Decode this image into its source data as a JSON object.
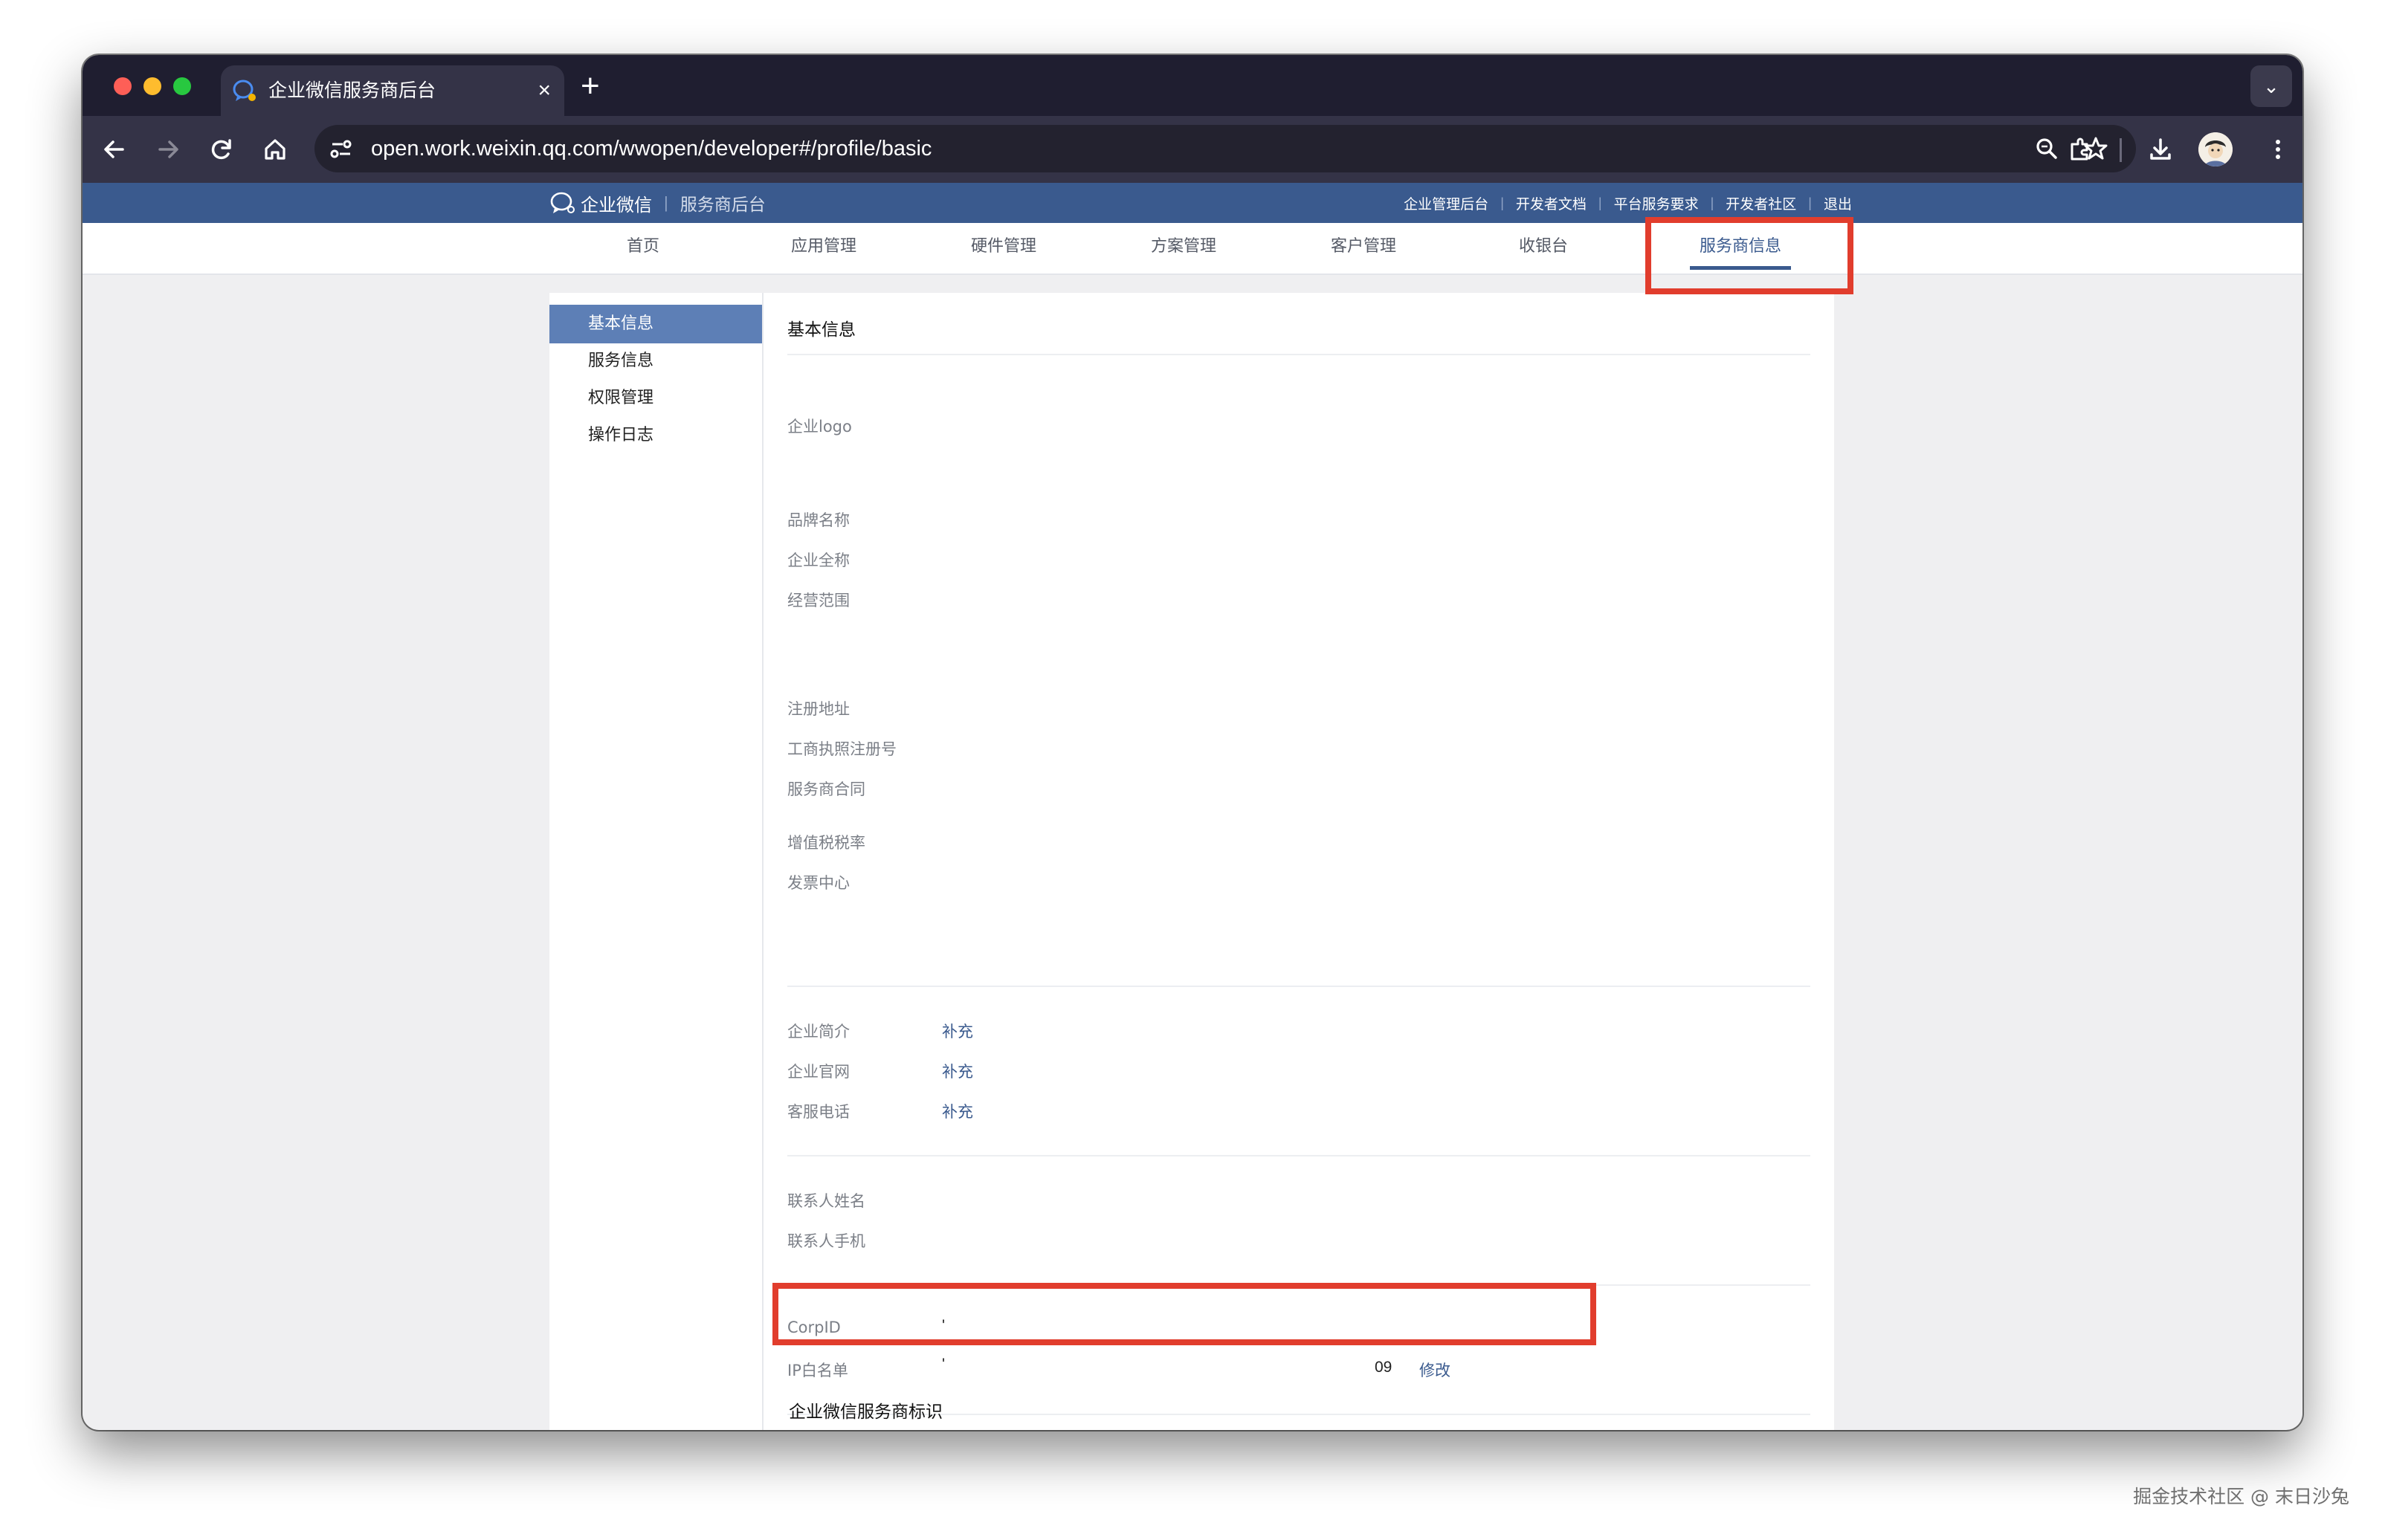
{
  "browser": {
    "tab_title": "企业微信服务商后台",
    "tab_close": "×",
    "new_tab": "+",
    "tab_menu": "⌄",
    "url": "open.work.weixin.qq.com/wwopen/developer#/profile/basic"
  },
  "header": {
    "logo_text": "企业微信",
    "separator": "|",
    "subtitle": "服务商后台",
    "links": [
      "企业管理后台",
      "开发者文档",
      "平台服务要求",
      "开发者社区",
      "退出"
    ],
    "link_separator": "|"
  },
  "nav": {
    "items": [
      "首页",
      "应用管理",
      "硬件管理",
      "方案管理",
      "客户管理",
      "收银台",
      "服务商信息"
    ],
    "active_index": 6
  },
  "sidebar": {
    "items": [
      "基本信息",
      "服务信息",
      "权限管理",
      "操作日志"
    ],
    "active_index": 0
  },
  "content": {
    "title": "基本信息",
    "logo_label": "企业logo",
    "brand_name_label": "品牌名称",
    "company_name_label": "企业全称",
    "business_scope_label": "经营范围",
    "address_label": "注册地址",
    "license_label": "工商执照注册号",
    "contract_label": "服务商合同",
    "tax_label": "增值税税率",
    "invoice_label": "发票中心",
    "intro_label": "企业简介",
    "website_label": "企业官网",
    "phone_label": "客服电话",
    "supplement_link": "补充",
    "contact_name_label": "联系人姓名",
    "contact_phone_label": "联系人手机",
    "corpid_label": "CorpID",
    "corpid_value": "'",
    "ip_label": "IP白名单",
    "ip_value_start": "'",
    "ip_value_end": "09",
    "ip_edit_link": "修改",
    "identity_title": "企业微信服务商标识"
  },
  "watermark": "掘金技术社区 @ 末日沙兔",
  "colors": {
    "header_bg": "#3a5a8e",
    "active_side_bg": "#5d7fb6",
    "highlight": "#e13d2d",
    "link": "#3a5a8e"
  },
  "icons": [
    "back-icon",
    "forward-icon",
    "reload-icon",
    "home-icon",
    "site-settings-icon",
    "zoom-icon",
    "bookmark-star-icon",
    "extensions-icon",
    "download-icon",
    "profile-avatar",
    "more-menu-icon"
  ]
}
